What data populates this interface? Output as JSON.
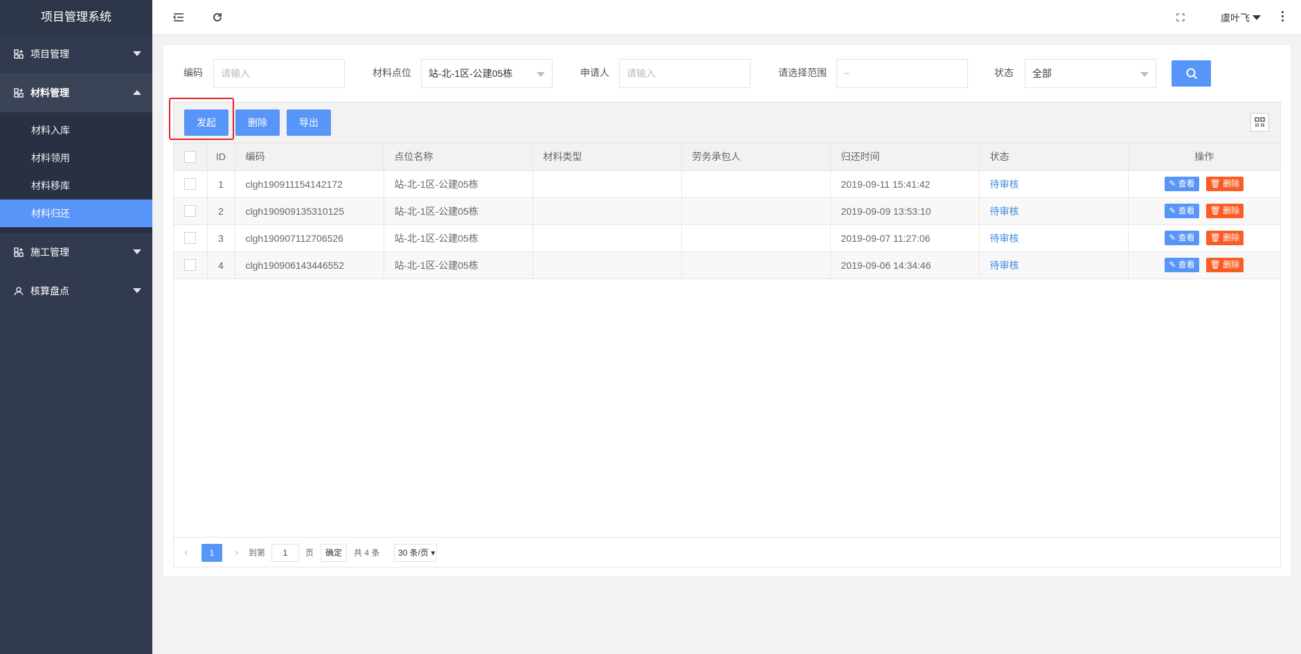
{
  "app": {
    "title": "项目管理系统"
  },
  "sidebar": {
    "items": [
      {
        "label": "项目管理",
        "icon": "grid-icon",
        "expanded": false
      },
      {
        "label": "材料管理",
        "icon": "grid-icon",
        "expanded": true,
        "children": [
          "材料入库",
          "材料领用",
          "材料移库",
          "材料归还"
        ],
        "active_child": "材料归还"
      },
      {
        "label": "施工管理",
        "icon": "grid-icon",
        "expanded": false
      },
      {
        "label": "核算盘点",
        "icon": "user-icon",
        "expanded": false
      }
    ]
  },
  "header": {
    "user": "虞叶飞"
  },
  "search": {
    "code_label": "编码",
    "code_placeholder": "请输入",
    "location_label": "材料点位",
    "location_value": "站-北-1区-公建05栋",
    "applicant_label": "申请人",
    "applicant_placeholder": "请输入",
    "range_label": "请选择范围",
    "range_placeholder": "~",
    "status_label": "状态",
    "status_value": "全部"
  },
  "toolbar": {
    "create": "发起",
    "delete": "删除",
    "export": "导出"
  },
  "table": {
    "headers": [
      "ID",
      "编码",
      "点位名称",
      "材料类型",
      "劳务承包人",
      "归还时间",
      "状态",
      "操作"
    ],
    "rows": [
      {
        "id": "1",
        "code": "clgh190911154142172",
        "location": "站-北-1区-公建05栋",
        "type": "",
        "contractor": "",
        "time": "2019-09-11 15:41:42",
        "status": "待审核"
      },
      {
        "id": "2",
        "code": "clgh190909135310125",
        "location": "站-北-1区-公建05栋",
        "type": "",
        "contractor": "",
        "time": "2019-09-09 13:53:10",
        "status": "待审核"
      },
      {
        "id": "3",
        "code": "clgh190907112706526",
        "location": "站-北-1区-公建05栋",
        "type": "",
        "contractor": "",
        "time": "2019-09-07 11:27:06",
        "status": "待审核"
      },
      {
        "id": "4",
        "code": "clgh190906143446552",
        "location": "站-北-1区-公建05栋",
        "type": "",
        "contractor": "",
        "time": "2019-09-06 14:34:46",
        "status": "待审核"
      }
    ],
    "view_label": "查看",
    "delete_label": "删除"
  },
  "pager": {
    "current": "1",
    "goto_label": "到第",
    "goto_value": "1",
    "page_unit": "页",
    "confirm": "确定",
    "total": "共 4 条",
    "page_size": "30 条/页"
  },
  "colors": {
    "primary": "#5795f8",
    "danger": "#f95c25",
    "sidebar": "#323a4f",
    "highlight": "#e02020"
  }
}
